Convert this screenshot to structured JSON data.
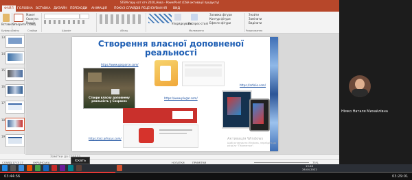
{
  "window": {
    "title": "STEM-пару кат отч 2020_Нова - PowerPoint (Сбій активації продукту)",
    "tabs": [
      "ФАЙЛ",
      "ГОЛОВНА",
      "ВСТАВКА",
      "ДИЗАЙН",
      "ПЕРЕХОДИ",
      "АНІМАЦІЯ",
      "ПОКАЗ СЛАЙДІВ",
      "РЕЦЕНЗУВАННЯ",
      "ВИД"
    ]
  },
  "ribbon": {
    "paste": "Вставити",
    "new_slide": "Створити слайд",
    "layout": "Макет",
    "reset": "Скинути",
    "section": "Розділ",
    "groups": [
      "Буфер обміну",
      "Слайди",
      "Шрифт",
      "Абзац",
      "Малювання",
      "Редагування"
    ],
    "arrange": "Упорядкувати",
    "quick_styles": "Експрес-стилі",
    "shape_fill": "Заливка фігури",
    "shape_outline": "Контур фігури",
    "shape_effects": "Ефекти фігури",
    "find": "Знайти",
    "replace": "Замінити",
    "select": "Виділити"
  },
  "thumbnails": [
    "13",
    "14",
    "15",
    "16",
    "17",
    "18",
    "19"
  ],
  "slide": {
    "title_line1": "Створення власної доповненої",
    "title_line2": "реальності",
    "link1": "https://www.gosparce.com/",
    "link2": "https://www.plugar.com/",
    "link3": "https://arfolio.com/",
    "link4": "https://arz.arfocus.com/",
    "caption": "Створи власну доповнену реальність у Cospaces",
    "watermark1": "Активація Windows",
    "watermark2": "Щоб активувати Windows, перейдіть до розділу \"Параметри\"."
  },
  "notes": {
    "placeholder": "Замітки до слайда"
  },
  "status": {
    "slide": "СЛАЙД 17 ІЗ 17",
    "lang": "УКРАЇНСЬКА",
    "notes": "НОТАТКИ",
    "comments": "ПРИМІТКИ",
    "zoom": "75%"
  },
  "taskbar": {
    "time": "13:46",
    "date": "26.04.2022"
  },
  "participant": {
    "name": "Німко Наталя Михайлівна"
  },
  "player": {
    "current_time": "03:44:56",
    "total_time": "03:29:01",
    "tooltip": "Іскать",
    "progress_fraction": 0.28
  },
  "colors": {
    "accent": "#b7472a",
    "title": "#1f5fb4"
  }
}
